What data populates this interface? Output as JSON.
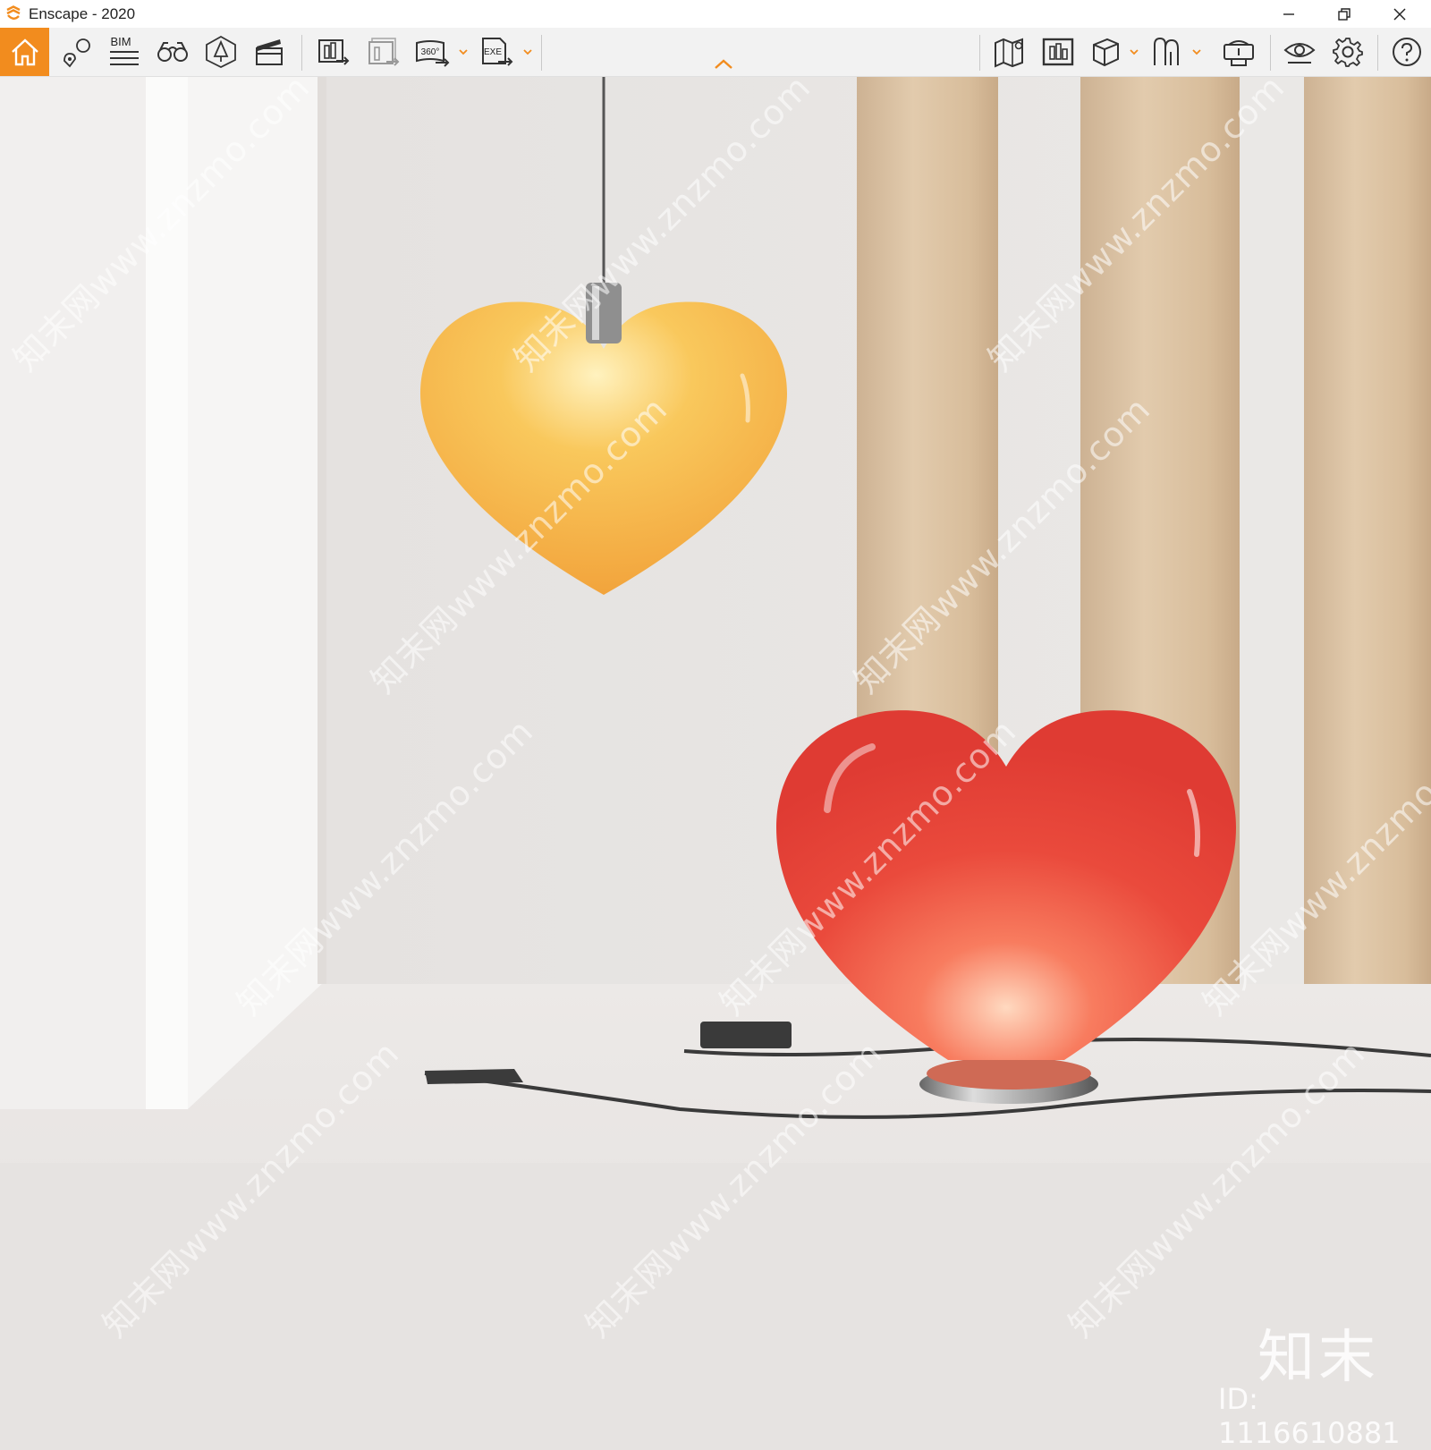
{
  "window": {
    "title": "Enscape - 2020",
    "controls": [
      "minimize",
      "restore",
      "close"
    ]
  },
  "toolbar": {
    "accent": "#f28c1e",
    "left_tools": [
      {
        "name": "home",
        "icon": "home-icon",
        "active": true
      },
      {
        "name": "views",
        "icon": "map-pin-icon"
      },
      {
        "name": "bim",
        "label": "BIM",
        "icon": "bim-list-icon"
      },
      {
        "name": "walk-mode",
        "icon": "binoculars-icon"
      },
      {
        "name": "atmosphere",
        "icon": "tree-icon"
      },
      {
        "name": "video-editor",
        "icon": "clapperboard-icon"
      },
      {
        "name": "render-image",
        "icon": "render-image-icon"
      },
      {
        "name": "batch-render",
        "icon": "batch-render-icon"
      },
      {
        "name": "panorama",
        "label": "360°",
        "icon": "panorama-icon",
        "dropdown": true
      },
      {
        "name": "export-exe",
        "label": "EXE",
        "icon": "export-exe-icon",
        "dropdown": true
      }
    ],
    "collapse_icon": "chevron-up-icon",
    "right_tools": [
      {
        "name": "map",
        "icon": "map-icon"
      },
      {
        "name": "screenshot-list",
        "icon": "gallery-icon"
      },
      {
        "name": "asset-library",
        "icon": "cube-icon",
        "dropdown": true
      },
      {
        "name": "materials",
        "icon": "material-icon",
        "dropdown": true
      },
      {
        "name": "vr-headset",
        "icon": "vr-headset-icon"
      },
      {
        "name": "visual-settings",
        "icon": "eye-icon"
      },
      {
        "name": "settings",
        "icon": "gear-icon"
      },
      {
        "name": "help",
        "icon": "help-icon"
      }
    ]
  },
  "viewport": {
    "scene": "heart-shaped lamps render",
    "watermark_text": "知末网www.znzmo.com",
    "brand_mark": "知末",
    "image_id": "ID: 1116610881"
  },
  "colors": {
    "pendant_lamp": "#f7b347",
    "table_lamp": "#e8463a",
    "wood": "#dcc3a3",
    "wall": "#e9e6e4"
  }
}
